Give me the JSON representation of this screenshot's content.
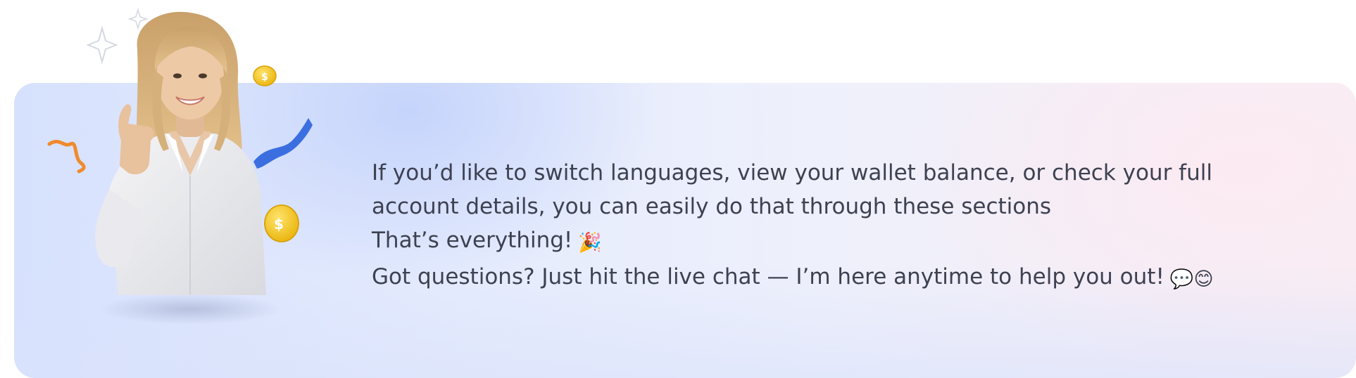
{
  "banner": {
    "lines": [
      "If you’d like to switch languages, view your wallet balance, or check your full",
      "account details, you can easily do that through these sections",
      "That’s everything!",
      "Got questions? Just hit the live chat — I’m here anytime to help you out!"
    ],
    "party_emoji": "🎉",
    "chat_emoji": "💬",
    "smile_emoji": "😊"
  },
  "illustration": {
    "coin_symbol": "$",
    "icons": [
      "sparkle-icon",
      "coin-icon",
      "ribbon-icon",
      "confetti-icon"
    ]
  },
  "colors": {
    "text": "#3d4151",
    "coin": "#f5c518",
    "ribbon_blue": "#3b6fe0",
    "confetti_orange": "#f08a2c"
  }
}
